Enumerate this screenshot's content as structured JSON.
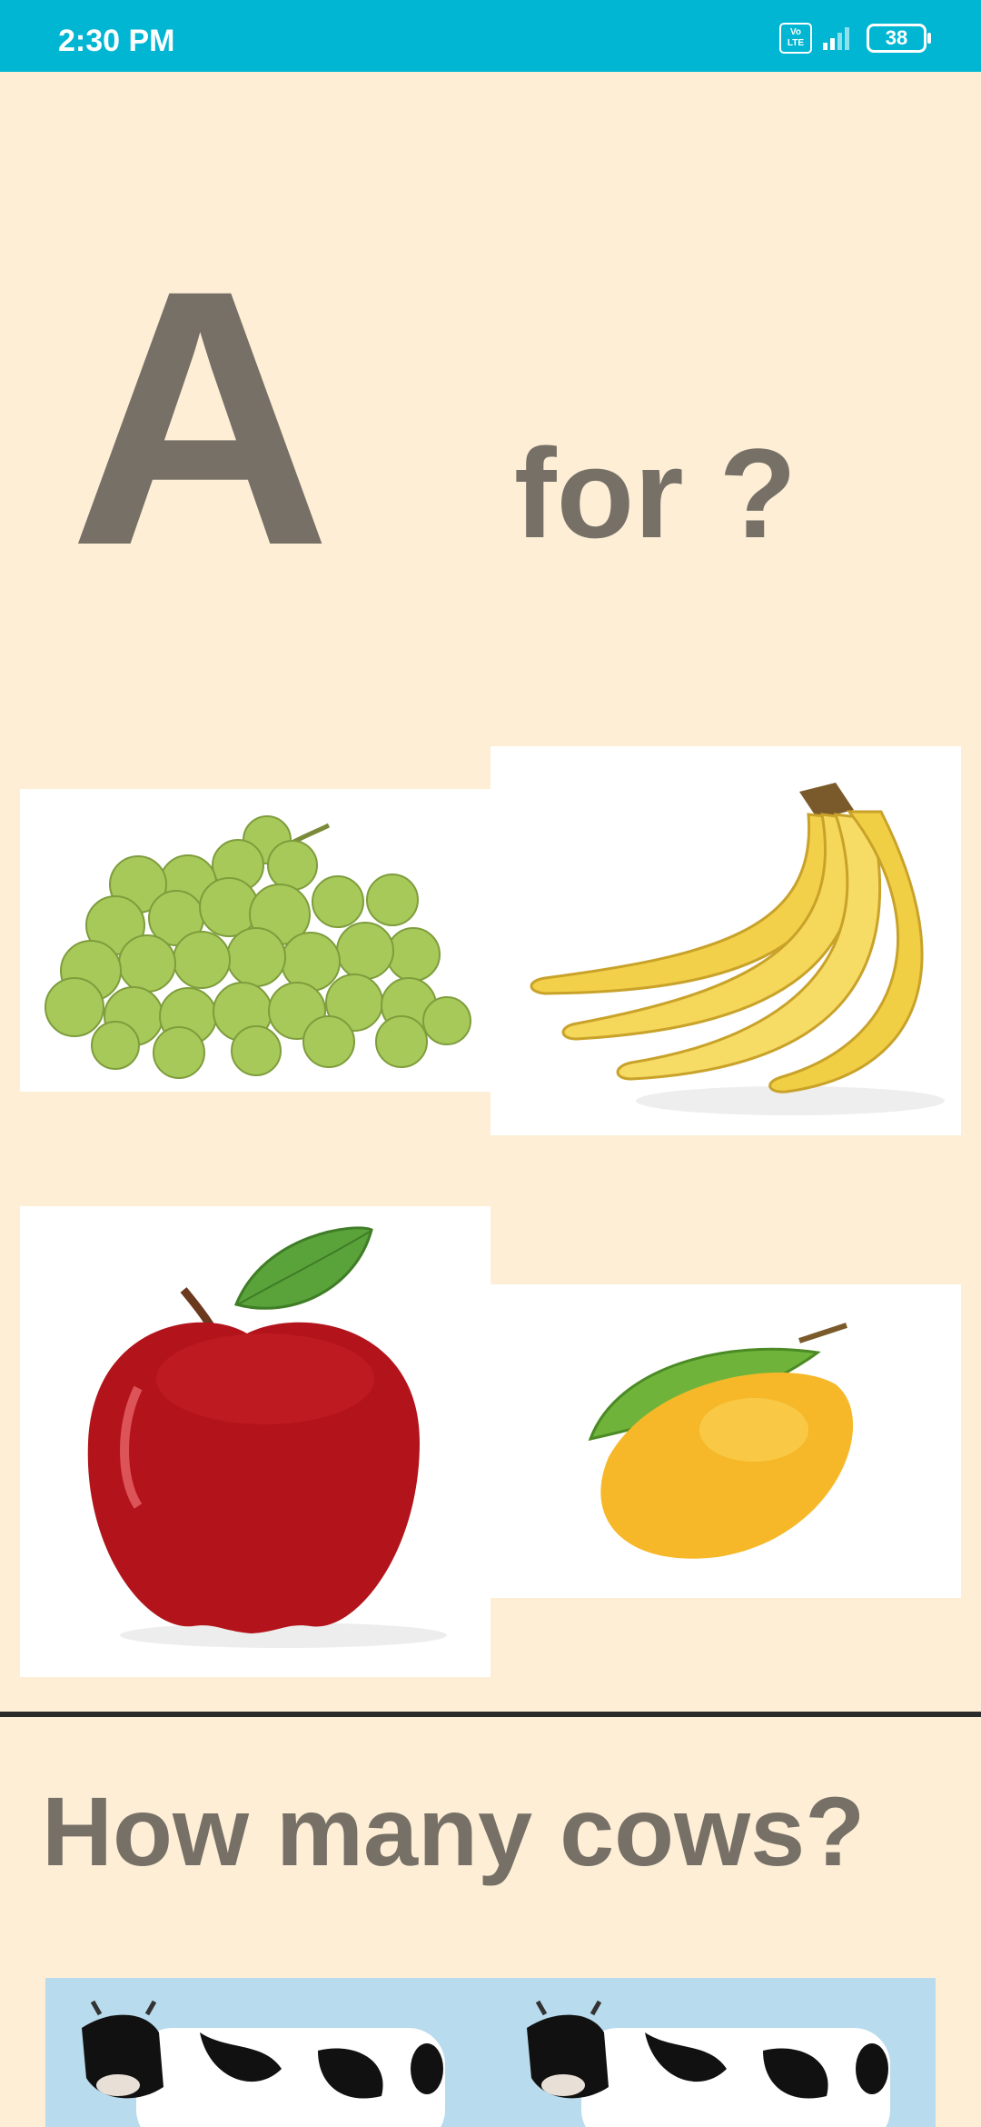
{
  "status_bar": {
    "time": "2:30 PM",
    "volte": "Vo LTE",
    "battery": "38"
  },
  "lesson": {
    "letter": "A",
    "prompt": "for ?"
  },
  "options": [
    {
      "name": "grapes-card",
      "icon": "grapes-icon"
    },
    {
      "name": "banana-card",
      "icon": "banana-icon"
    },
    {
      "name": "apple-card",
      "icon": "apple-icon"
    },
    {
      "name": "mango-card",
      "icon": "mango-icon"
    }
  ],
  "counting": {
    "question": "How many cows?",
    "icon": "cow-icon"
  },
  "colors": {
    "status_bar": "#00b6d3",
    "background": "#fdeed5",
    "text": "#767067"
  }
}
